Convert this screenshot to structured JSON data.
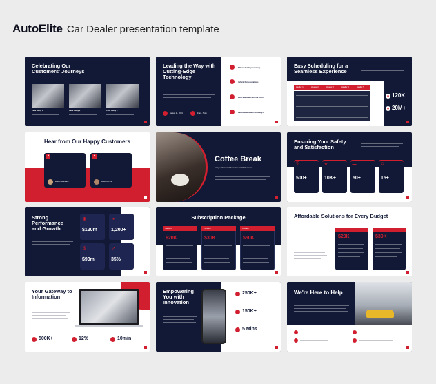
{
  "header": {
    "brand": "AutoElite",
    "subtitle": "Car Dealer presentation template"
  },
  "slides": {
    "s1": {
      "title": "Celebrating Our Customers' Journeys",
      "cases": [
        "Case Study 1",
        "Case Study 2",
        "Case Study 3"
      ]
    },
    "s2": {
      "title": "Leading the Way with Cutting-Edge Technology",
      "timeline": [
        "Ribbon Cutting Ceremony",
        "Vehicle Demonstrations",
        "Meet and Greet with the Team",
        "Refreshments and Giveaways"
      ],
      "date": "August 11, 2024",
      "time": "9 am - 5 pm"
    },
    "s3": {
      "title": "Easy Scheduling for a Seamless Experience",
      "cols": [
        "Header 1",
        "Header 2",
        "Header 3",
        "Header 4",
        "Header 5"
      ],
      "stat1": "120K",
      "stat2": "20M+"
    },
    "s4": {
      "title": "Hear from Our Happy Customers",
      "names": [
        "William Hamilton",
        "Leonard Pine"
      ]
    },
    "s5": {
      "title": "Coffee Break",
      "sub": "Enjoy a Moment of Relaxation and Refreshment"
    },
    "s6": {
      "title": "Ensuring Your Safety and Satisfaction",
      "stats": [
        "500+",
        "10K+",
        "50+",
        "15+"
      ]
    },
    "s7": {
      "title": "Strong Performance and Growth",
      "stats": [
        "$120m",
        "1,200+",
        "$90m",
        "35%"
      ]
    },
    "s8": {
      "title": "Subscription Package",
      "plans": [
        "Standard",
        "Premium",
        "Ultimate"
      ],
      "prices": [
        "$20K",
        "$30K",
        "$50K"
      ]
    },
    "s9": {
      "title": "Affordable Solutions for Every Budget",
      "prices": [
        "$20K",
        "$30K"
      ]
    },
    "s10": {
      "title": "Your Gateway to Information",
      "stats": [
        "500K+",
        "12%",
        "10min"
      ]
    },
    "s11": {
      "title": "Empowering You with Innovation",
      "stats": [
        "250K+",
        "150K+",
        "5 Mins"
      ]
    },
    "s12": {
      "title": "We're Here to Help"
    }
  }
}
